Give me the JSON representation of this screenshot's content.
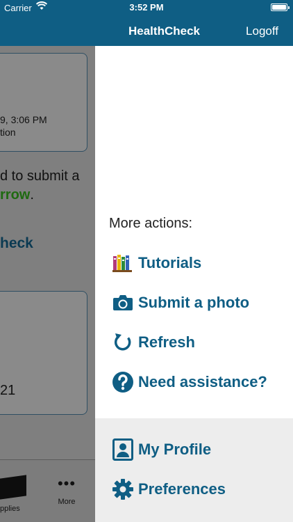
{
  "status_bar": {
    "carrier": "Carrier",
    "time": "3:52 PM"
  },
  "nav": {
    "title": "HealthCheck",
    "logoff": "Logoff"
  },
  "background": {
    "card_line1": "9, 3:06 PM",
    "card_line2": "tion",
    "text_line1": "d to submit a",
    "text_line2_prefix": "",
    "text_line2_green": "rrow",
    "text_line2_suffix": ".",
    "link_text": "heck",
    "card2_text": "21",
    "tabs": {
      "supplies": "pplies",
      "more": "More"
    }
  },
  "drawer": {
    "heading": "More actions:",
    "items": [
      {
        "label": "Tutorials",
        "icon": "books-icon"
      },
      {
        "label": "Submit a photo",
        "icon": "camera-icon"
      },
      {
        "label": "Refresh",
        "icon": "refresh-icon"
      },
      {
        "label": "Need assistance?",
        "icon": "question-icon"
      }
    ],
    "footer_items": [
      {
        "label": "My Profile",
        "icon": "profile-icon"
      },
      {
        "label": "Preferences",
        "icon": "gear-icon"
      }
    ]
  },
  "colors": {
    "brand": "#0f5e84",
    "accent_green": "#1e6a10",
    "drawer_footer_bg": "#ededed"
  }
}
